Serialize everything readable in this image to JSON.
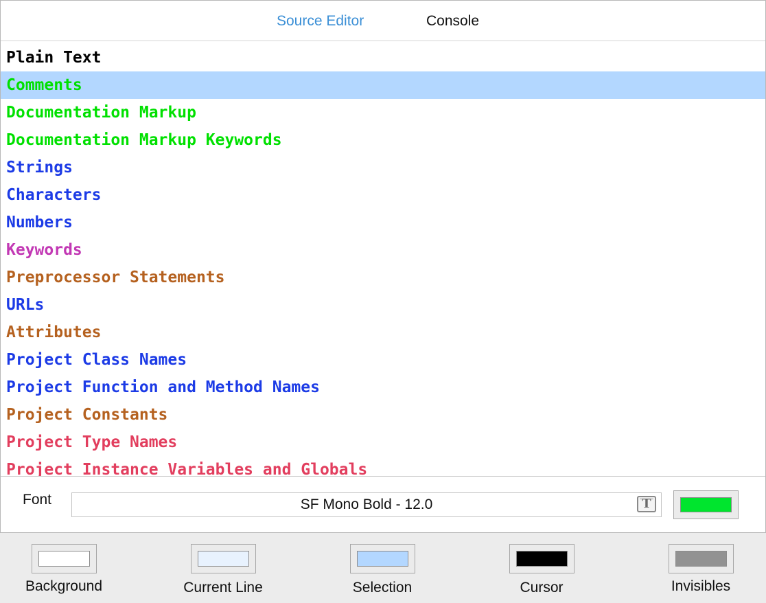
{
  "tabs": [
    {
      "label": "Source Editor",
      "active": true
    },
    {
      "label": "Console",
      "active": false
    }
  ],
  "syntax_items": [
    {
      "label": "Plain Text",
      "color": "#000000",
      "selected": false
    },
    {
      "label": "Comments",
      "color": "#00e000",
      "selected": true
    },
    {
      "label": "Documentation Markup",
      "color": "#00e000",
      "selected": false
    },
    {
      "label": "Documentation Markup Keywords",
      "color": "#00e000",
      "selected": false
    },
    {
      "label": "Strings",
      "color": "#1c3be6",
      "selected": false
    },
    {
      "label": "Characters",
      "color": "#1c3be6",
      "selected": false
    },
    {
      "label": "Numbers",
      "color": "#1c3be6",
      "selected": false
    },
    {
      "label": "Keywords",
      "color": "#c238b4",
      "selected": false
    },
    {
      "label": "Preprocessor Statements",
      "color": "#b5611f",
      "selected": false
    },
    {
      "label": "URLs",
      "color": "#1c3be6",
      "selected": false
    },
    {
      "label": "Attributes",
      "color": "#b5611f",
      "selected": false
    },
    {
      "label": "Project Class Names",
      "color": "#1c3be6",
      "selected": false
    },
    {
      "label": "Project Function and Method Names",
      "color": "#1c3be6",
      "selected": false
    },
    {
      "label": "Project Constants",
      "color": "#b5611f",
      "selected": false
    },
    {
      "label": "Project Type Names",
      "color": "#e23e5e",
      "selected": false
    },
    {
      "label": "Project Instance Variables and Globals",
      "color": "#e23e5e",
      "selected": false
    }
  ],
  "font": {
    "label": "Font",
    "value": "SF Mono Bold - 12.0",
    "picker_icon": "font-T-icon",
    "text_color": "#00e52e"
  },
  "colors": [
    {
      "label": "Background",
      "swatch": "#ffffff"
    },
    {
      "label": "Current Line",
      "swatch": "#e8f2fe"
    },
    {
      "label": "Selection",
      "swatch": "#b3d7ff"
    },
    {
      "label": "Cursor",
      "swatch": "#000000"
    },
    {
      "label": "Invisibles",
      "swatch": "#929292"
    }
  ]
}
